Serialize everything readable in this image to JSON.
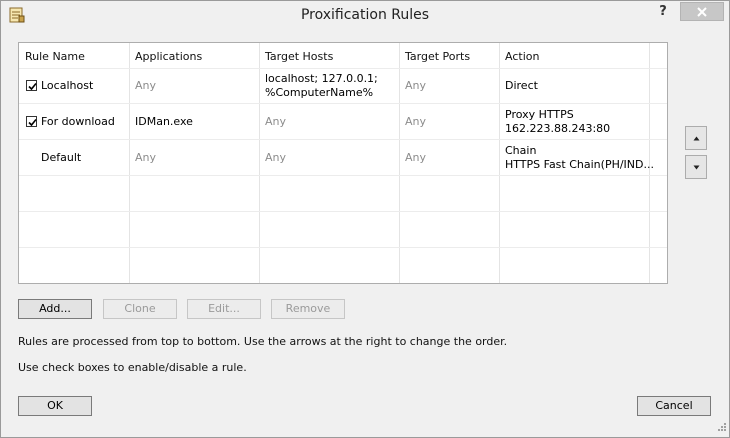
{
  "window": {
    "title": "Proxification Rules",
    "help": "?"
  },
  "table": {
    "headers": [
      "Rule Name",
      "Applications",
      "Target Hosts",
      "Target Ports",
      "Action"
    ],
    "rows": [
      {
        "checked": true,
        "name": "Localhost",
        "applications": "Any",
        "hosts_line1": "localhost; 127.0.0.1;",
        "hosts_line2": "%ComputerName%",
        "ports": "Any",
        "action_line1": "Direct",
        "action_line2": ""
      },
      {
        "checked": true,
        "name": "For download",
        "applications": "IDMan.exe",
        "hosts_line1": "Any",
        "hosts_line2": "",
        "ports": "Any",
        "action_line1": "Proxy HTTPS",
        "action_line2": "162.223.88.243:80"
      },
      {
        "checked": false,
        "name": "Default",
        "applications": "Any",
        "hosts_line1": "Any",
        "hosts_line2": "",
        "ports": "Any",
        "action_line1": "Chain",
        "action_line2": "HTTPS Fast Chain(PH/IND..."
      }
    ]
  },
  "buttons": {
    "add": "Add...",
    "clone": "Clone",
    "edit": "Edit...",
    "remove": "Remove",
    "ok": "OK",
    "cancel": "Cancel"
  },
  "info": {
    "line1": "Rules are processed from top to bottom. Use the arrows at the right to change the order.",
    "line2": "Use check boxes to enable/disable a rule."
  },
  "icons": {
    "app": "rules-list-icon",
    "close": "close-icon",
    "up": "arrow-up-icon",
    "down": "arrow-down-icon",
    "check": "checkmark-icon",
    "grip": "resize-grip-icon"
  }
}
